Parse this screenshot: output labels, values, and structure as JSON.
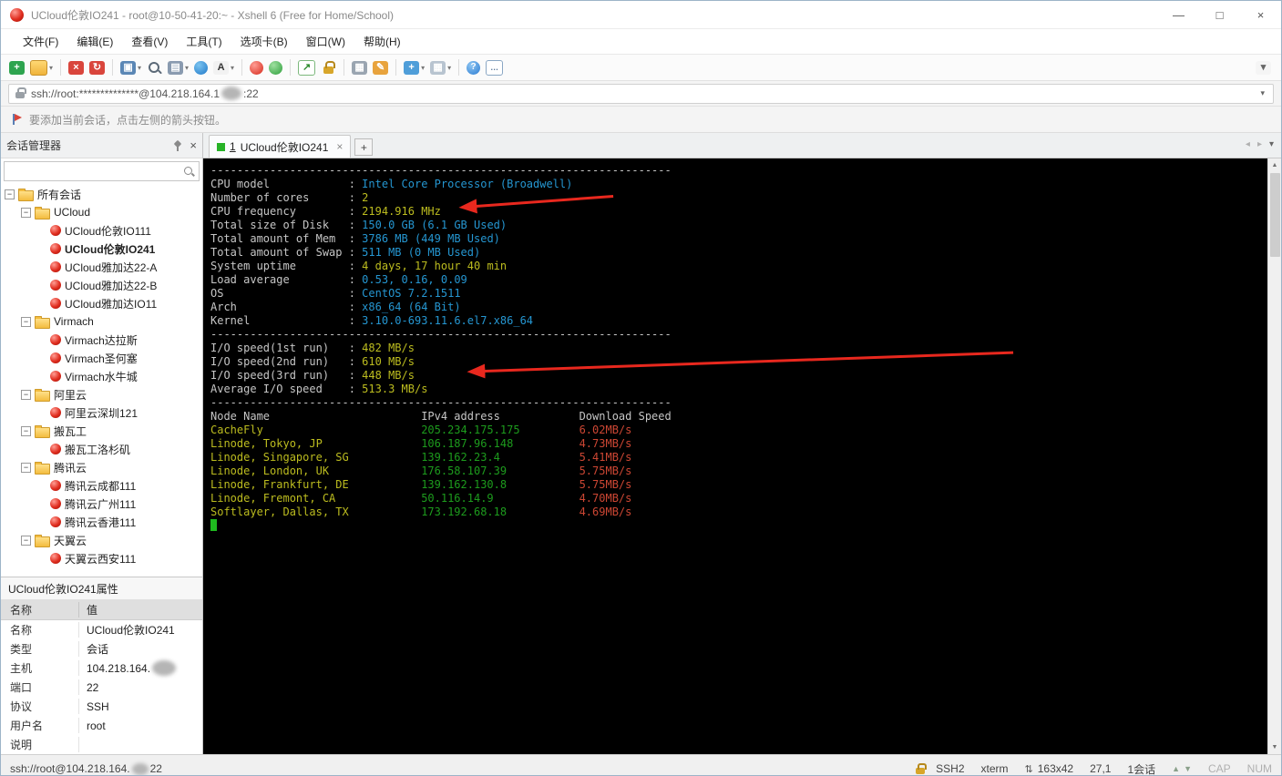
{
  "window": {
    "title": "UCloud伦敦IO241 - root@10-50-41-20:~ - Xshell 6 (Free for Home/School)"
  },
  "icons": {
    "dropdown": "▾",
    "close": "×",
    "minimize": "—",
    "maximize": "□",
    "plus": "+",
    "tab_scroll_left": "◂",
    "tab_scroll_right": "▸",
    "scroll_up": "▲",
    "scroll_down": "▼",
    "size_indicator": "⇅"
  },
  "menu": {
    "items": [
      {
        "name": "file",
        "label": "文件(F)"
      },
      {
        "name": "edit",
        "label": "编辑(E)"
      },
      {
        "name": "view",
        "label": "查看(V)"
      },
      {
        "name": "tools",
        "label": "工具(T)"
      },
      {
        "name": "tabs",
        "label": "选项卡(B)"
      },
      {
        "name": "window",
        "label": "窗口(W)"
      },
      {
        "name": "help",
        "label": "帮助(H)"
      }
    ]
  },
  "toolbar": {
    "items": [
      {
        "name": "new-session-button",
        "color": "#2ea44f",
        "glyph": "+"
      },
      {
        "name": "open-session-button",
        "cls": "folder",
        "dropdown": true
      },
      {
        "sep": true
      },
      {
        "name": "disconnect-button",
        "color": "#d9453c",
        "glyph": "×"
      },
      {
        "name": "reconnect-button",
        "color": "#d9453c",
        "glyph": "↻"
      },
      {
        "sep": true
      },
      {
        "name": "duplicate-session-button",
        "color": "#5b87b5",
        "glyph": "▣",
        "dropdown": true
      },
      {
        "name": "find-button",
        "cls": "search"
      },
      {
        "name": "tab-arrange-button",
        "color": "#8a9bb0",
        "glyph": "▤",
        "dropdown": true
      },
      {
        "name": "encoding-button",
        "cls": "globe"
      },
      {
        "name": "font-button",
        "color": "#f2f2f2",
        "fg": "#333333",
        "glyph": "A",
        "dropdown": true
      },
      {
        "sep": true
      },
      {
        "name": "xshell-button",
        "cls": "ball-red"
      },
      {
        "name": "xftp-button",
        "cls": "ball-green"
      },
      {
        "sep": true
      },
      {
        "name": "fullscreen-button",
        "cls": "outlined",
        "color": "#ffffff",
        "fg": "#2c8a2c",
        "glyph": "↗"
      },
      {
        "name": "lock-screen-button",
        "cls": "locktile"
      },
      {
        "sep": true
      },
      {
        "name": "compose-bar-button",
        "color": "#9aa5b1",
        "glyph": "▦"
      },
      {
        "name": "highlight-button",
        "color": "#e8a33d",
        "glyph": "✎"
      },
      {
        "sep": true
      },
      {
        "name": "new-file-transfer-button",
        "color": "#4f9ed9",
        "glyph": "+",
        "dropdown": true
      },
      {
        "name": "window-layout-button",
        "color": "#b8c4d0",
        "glyph": "▦",
        "dropdown": true
      },
      {
        "sep": true
      },
      {
        "name": "help-button",
        "cls": "ball-blue",
        "glyph": "?"
      },
      {
        "name": "message-button",
        "cls": "bubble",
        "glyph": "…"
      },
      {
        "spacer": true
      },
      {
        "name": "toolbar-overflow-button",
        "color": "#f5f5f5",
        "fg": "#666666",
        "glyph": "▾"
      }
    ]
  },
  "address_bar": {
    "before_blur": "ssh://root:**************@104.218.164.1",
    "after_blur": ":22"
  },
  "info_bar": {
    "text": "要添加当前会话，点击左侧的箭头按钮。"
  },
  "sidebar": {
    "title": "会话管理器",
    "tree": [
      {
        "name": "all-sessions",
        "label": "所有会话",
        "kind": "folder",
        "depth": 0,
        "expand": true
      },
      {
        "name": "folder-ucloud",
        "label": "UCloud",
        "kind": "folder",
        "depth": 1,
        "expand": true
      },
      {
        "name": "session-ucloud-london-io111",
        "label": "UCloud伦敦IO111",
        "kind": "session",
        "depth": 2
      },
      {
        "name": "session-ucloud-london-io241",
        "label": "UCloud伦敦IO241",
        "kind": "session",
        "depth": 2,
        "selected": true
      },
      {
        "name": "session-ucloud-jakarta-22-a",
        "label": "UCloud雅加达22-A",
        "kind": "session",
        "depth": 2
      },
      {
        "name": "session-ucloud-jakarta-22-b",
        "label": "UCloud雅加达22-B",
        "kind": "session",
        "depth": 2
      },
      {
        "name": "session-ucloud-jakarta-io11",
        "label": "UCloud雅加达IO11",
        "kind": "session",
        "depth": 2
      },
      {
        "name": "folder-virmach",
        "label": "Virmach",
        "kind": "folder",
        "depth": 1,
        "expand": true
      },
      {
        "name": "session-virmach-dallas",
        "label": "Virmach达拉斯",
        "kind": "session",
        "depth": 2
      },
      {
        "name": "session-virmach-san-jose",
        "label": "Virmach圣何塞",
        "kind": "session",
        "depth": 2
      },
      {
        "name": "session-virmach-buffalo",
        "label": "Virmach水牛城",
        "kind": "session",
        "depth": 2
      },
      {
        "name": "folder-aliyun",
        "label": "阿里云",
        "kind": "folder",
        "depth": 1,
        "expand": true
      },
      {
        "name": "session-aliyun-shenzhen-121",
        "label": "阿里云深圳121",
        "kind": "session",
        "depth": 2
      },
      {
        "name": "folder-bandwagon",
        "label": "搬瓦工",
        "kind": "folder",
        "depth": 1,
        "expand": true
      },
      {
        "name": "session-bandwagon-losangeles",
        "label": "搬瓦工洛杉矶",
        "kind": "session",
        "depth": 2
      },
      {
        "name": "folder-tencent",
        "label": "腾讯云",
        "kind": "folder",
        "depth": 1,
        "expand": true
      },
      {
        "name": "session-tencent-chengdu-111",
        "label": "腾讯云成都111",
        "kind": "session",
        "depth": 2
      },
      {
        "name": "session-tencent-guangzhou-111",
        "label": "腾讯云广州111",
        "kind": "session",
        "depth": 2
      },
      {
        "name": "session-tencent-hongkong-111",
        "label": "腾讯云香港111",
        "kind": "session",
        "depth": 2
      },
      {
        "name": "folder-tianyi",
        "label": "天翼云",
        "kind": "folder",
        "depth": 1,
        "expand": true
      },
      {
        "name": "session-tianyi-xian-111",
        "label": "天翼云西安111",
        "kind": "session",
        "depth": 2
      }
    ]
  },
  "properties": {
    "title": "UCloud伦敦IO241属性",
    "columns": [
      "名称",
      "值"
    ],
    "rows": [
      {
        "name": "name",
        "label": "名称",
        "value": "UCloud伦敦IO241"
      },
      {
        "name": "type",
        "label": "类型",
        "value": "会话"
      },
      {
        "name": "host",
        "label": "主机",
        "value": "104.218.164.",
        "blur": true
      },
      {
        "name": "port",
        "label": "端口",
        "value": "22"
      },
      {
        "name": "protocol",
        "label": "协议",
        "value": "SSH"
      },
      {
        "name": "username",
        "label": "用户名",
        "value": "root"
      },
      {
        "name": "description",
        "label": "说明",
        "value": ""
      }
    ]
  },
  "tabs": {
    "active": {
      "number": "1",
      "label": "UCloud伦敦IO241"
    }
  },
  "terminal": {
    "palette": {
      "bg": "#000000",
      "w": "#c6c6c6",
      "b": "#2596d1",
      "y": "#bcbc1f",
      "g": "#1d9b1d",
      "r": "#cc4633",
      "cursor": "#1fba1f"
    },
    "lines": [
      {
        "s": [
          [
            "w",
            "----------------------------------------------------------------------"
          ]
        ]
      },
      {
        "s": [
          [
            "w",
            "CPU model            : "
          ],
          [
            "b",
            "Intel Core Processor (Broadwell)"
          ]
        ]
      },
      {
        "s": [
          [
            "w",
            "Number of cores      : "
          ],
          [
            "y",
            "2"
          ]
        ]
      },
      {
        "s": [
          [
            "w",
            "CPU frequency        : "
          ],
          [
            "y",
            "2194.916 MHz"
          ]
        ]
      },
      {
        "s": [
          [
            "w",
            "Total size of Disk   : "
          ],
          [
            "b",
            "150.0 GB (6.1 GB Used)"
          ]
        ]
      },
      {
        "s": [
          [
            "w",
            "Total amount of Mem  : "
          ],
          [
            "b",
            "3786 MB (449 MB Used)"
          ]
        ]
      },
      {
        "s": [
          [
            "w",
            "Total amount of Swap : "
          ],
          [
            "b",
            "511 MB (0 MB Used)"
          ]
        ]
      },
      {
        "s": [
          [
            "w",
            "System uptime        : "
          ],
          [
            "y",
            "4 days, 17 hour 40 min"
          ]
        ]
      },
      {
        "s": [
          [
            "w",
            "Load average         : "
          ],
          [
            "b",
            "0.53, 0.16, 0.09"
          ]
        ]
      },
      {
        "s": [
          [
            "w",
            "OS                   : "
          ],
          [
            "b",
            "CentOS 7.2.1511"
          ]
        ]
      },
      {
        "s": [
          [
            "w",
            "Arch                 : "
          ],
          [
            "b",
            "x86_64 (64 Bit)"
          ]
        ]
      },
      {
        "s": [
          [
            "w",
            "Kernel               : "
          ],
          [
            "b",
            "3.10.0-693.11.6.el7.x86_64"
          ]
        ]
      },
      {
        "s": [
          [
            "w",
            "----------------------------------------------------------------------"
          ]
        ]
      },
      {
        "s": [
          [
            "w",
            "I/O speed(1st run)   : "
          ],
          [
            "y",
            "482 MB/s"
          ]
        ]
      },
      {
        "s": [
          [
            "w",
            "I/O speed(2nd run)   : "
          ],
          [
            "y",
            "610 MB/s"
          ]
        ]
      },
      {
        "s": [
          [
            "w",
            "I/O speed(3rd run)   : "
          ],
          [
            "y",
            "448 MB/s"
          ]
        ]
      },
      {
        "s": [
          [
            "w",
            "Average I/O speed    : "
          ],
          [
            "y",
            "513.3 MB/s"
          ]
        ]
      },
      {
        "s": [
          [
            "w",
            "----------------------------------------------------------------------"
          ]
        ]
      },
      {
        "s": [
          [
            "w",
            "Node Name                       IPv4 address            Download Speed"
          ]
        ]
      },
      {
        "s": [
          [
            "y",
            "CacheFly                        "
          ],
          [
            "g",
            "205.234.175.175         "
          ],
          [
            "r",
            "6.02MB/s"
          ]
        ]
      },
      {
        "s": [
          [
            "y",
            "Linode, Tokyo, JP               "
          ],
          [
            "g",
            "106.187.96.148          "
          ],
          [
            "r",
            "4.73MB/s"
          ]
        ]
      },
      {
        "s": [
          [
            "y",
            "Linode, Singapore, SG           "
          ],
          [
            "g",
            "139.162.23.4            "
          ],
          [
            "r",
            "5.41MB/s"
          ]
        ]
      },
      {
        "s": [
          [
            "y",
            "Linode, London, UK              "
          ],
          [
            "g",
            "176.58.107.39           "
          ],
          [
            "r",
            "5.75MB/s"
          ]
        ]
      },
      {
        "s": [
          [
            "y",
            "Linode, Frankfurt, DE           "
          ],
          [
            "g",
            "139.162.130.8           "
          ],
          [
            "r",
            "5.75MB/s"
          ]
        ]
      },
      {
        "s": [
          [
            "y",
            "Linode, Fremont, CA             "
          ],
          [
            "g",
            "50.116.14.9             "
          ],
          [
            "r",
            "4.70MB/s"
          ]
        ]
      },
      {
        "s": [
          [
            "y",
            "Softlayer, Dallas, TX           "
          ],
          [
            "g",
            "173.192.68.18           "
          ],
          [
            "r",
            "4.69MB/s"
          ]
        ]
      },
      {
        "cursor": true
      }
    ]
  },
  "status": {
    "url_before": "ssh://root@104.218.164.",
    "url_after": "22",
    "encryption": "SSH2",
    "terminal_type": "xterm",
    "size": "163x42",
    "cursor_position": "27,1",
    "session_count": "1会话",
    "caps_lock": "CAP",
    "num_lock": "NUM"
  },
  "annotations": {
    "arrow_color": "#e8281e"
  }
}
